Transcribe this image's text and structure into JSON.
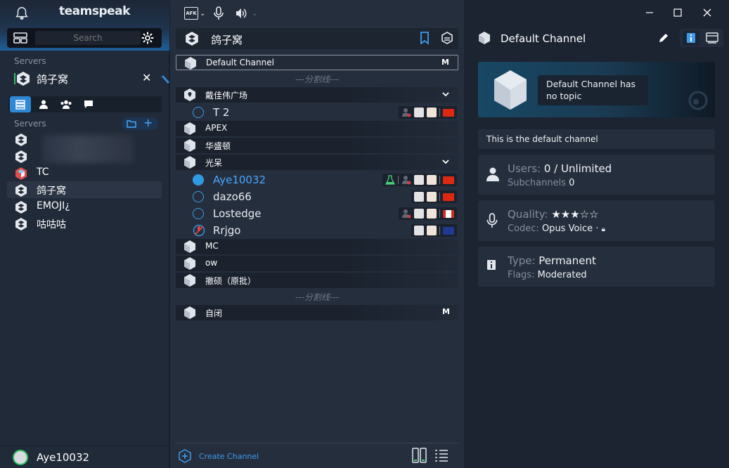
{
  "app": {
    "logo": "teamspeak",
    "search_placeholder": "Search"
  },
  "sidebar": {
    "servers_label": "Servers",
    "current_server": "鸽子窝",
    "servers_label2": "Servers",
    "servers": [
      {
        "name": "TC"
      },
      {
        "name": "鸽子窝"
      },
      {
        "name": "EMOJI¿"
      },
      {
        "name": "咕咕咕"
      }
    ],
    "user": "Aye10032"
  },
  "toolbar": {
    "afk_label": "AFK"
  },
  "channel_tree": {
    "server_name": "鸽子窝",
    "channels": [
      {
        "name": "Default Channel",
        "flag": "M"
      },
      {
        "spacer": "---分割线---"
      },
      {
        "name": "戴佳伟广场"
      },
      {
        "name": "APEX"
      },
      {
        "name": "华盛顿"
      },
      {
        "name": "光呆"
      },
      {
        "name": "MC"
      },
      {
        "name": "ow"
      },
      {
        "name": "撤硕（原批）"
      },
      {
        "spacer": "---分割线---"
      },
      {
        "name": "自闭",
        "flag": "M"
      }
    ],
    "clients": {
      "t2": "T 2",
      "aye": "Aye10032",
      "dazo": "dazo66",
      "lost": "Lostedge",
      "rrjgo": "Rrjgo"
    },
    "create_channel": "Create Channel"
  },
  "info": {
    "channel_name": "Default Channel",
    "topic": "Default Channel has no topic",
    "description": "This is the default channel",
    "users_label": "Users:",
    "users_value": "0 / Unlimited",
    "subchannels_label": "Subchannels",
    "subchannels_value": "0",
    "quality_label": "Quality:",
    "quality_value": "★★★☆☆",
    "codec_label": "Codec:",
    "codec_value": "Opus Voice ·",
    "type_label": "Type:",
    "type_value": "Permanent",
    "flags_label": "Flags:",
    "flags_value": "Moderated"
  },
  "colors": {
    "accent": "#2f88d6",
    "self_name": "#4aa8ff"
  }
}
